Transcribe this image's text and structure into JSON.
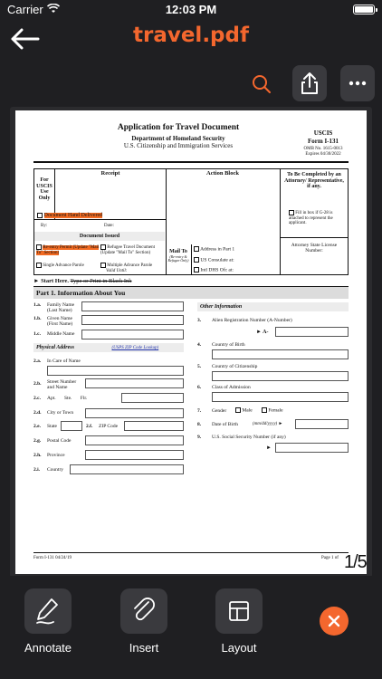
{
  "status_bar": {
    "carrier": "Carrier",
    "time": "12:03 PM"
  },
  "header": {
    "title": "travel.pdf"
  },
  "pdf": {
    "form_title": "Application for Travel Document",
    "dept": "Department of Homeland Security",
    "agency": "U.S. Citizenship and Immigration Services",
    "uscis": "USCIS",
    "form_no": "Form I-131",
    "omb": "OMB No. 1615-0013",
    "expires": "Expires 04/30/2022",
    "receipt": "Receipt",
    "action_block": "Action Block",
    "for_uscis_use_only": "For USCIS Use Only",
    "to_be_completed": "To Be Completed by an Attorney/ Representative, if any.",
    "document_hand_delivered": "Document Hand Delivered",
    "by": "By:",
    "date": "Date:",
    "document_issued": "Document Issued",
    "reentry_permit": "Re-entry Permit (Update \"Mail To\" Section)",
    "refugee_travel": "Refugee Travel Document (Update \"Mail To\" Section)",
    "single_parole": "Single Advance Parole",
    "multiple_parole": "Multiple Advance Parole",
    "valid_until": "Valid Until:",
    "mail_to": "Mail To",
    "mail_to_sub": "(Re-entry & Refugee Only)",
    "address_in_part1": "Address in Part 1",
    "us_consulate": "US Consulate at:",
    "intl_dhs": "Intl DHS Ofc at:",
    "fill_g28": "Fill in box if G-28 is attached to represent the applicant.",
    "attorney_license": "Attorney State License Number:",
    "start_here": "Start Here.",
    "type_or_print": "Type or Print in Black Ink",
    "part1": "Part 1.  Information About You",
    "other_info": "Other Information",
    "labels_left": [
      {
        "num": "1.a.",
        "text": "Family Name (Last Name)"
      },
      {
        "num": "1.b.",
        "text": "Given Name (First Name)"
      },
      {
        "num": "1.c.",
        "text": "Middle Name"
      }
    ],
    "physical_address": "Physical Address",
    "zip_lookup": "(USPS ZIP Code Lookup)",
    "addr_labels": [
      {
        "num": "2.a.",
        "text": "In Care of Name"
      },
      {
        "num": "2.b.",
        "text": "Street Number and Name"
      },
      {
        "num": "2.c.",
        "text": "Apt.   Ste.   Flr."
      },
      {
        "num": "2.d.",
        "text": "City or Town"
      },
      {
        "num": "2.e.",
        "text": "State"
      },
      {
        "num": "2.f.",
        "text": "ZIP Code"
      },
      {
        "num": "2.g.",
        "text": "Postal Code"
      },
      {
        "num": "2.h.",
        "text": "Province"
      },
      {
        "num": "2.i.",
        "text": "Country"
      }
    ],
    "right_labels": [
      {
        "num": "3.",
        "text": "Alien Registration Number (A-Number)"
      },
      {
        "num": "4.",
        "text": "Country of Birth"
      },
      {
        "num": "5.",
        "text": "Country of Citizenship"
      },
      {
        "num": "6.",
        "text": "Class of Admission"
      },
      {
        "num": "7.",
        "text": "Gender"
      },
      {
        "num": "8.",
        "text": "Date of Birth"
      },
      {
        "num": "9.",
        "text": "U.S. Social Security Number (if any)"
      }
    ],
    "a_prefix": "► A-",
    "male": "Male",
    "female": "Female",
    "dob_fmt": "(mm/dd/yyyy) ►",
    "footer_left": "Form I-131  04/24/19",
    "footer_right": "Page 1 of"
  },
  "page_indicator": "1/5",
  "bottom_bar": {
    "annotate": "Annotate",
    "insert": "Insert",
    "layout": "Layout"
  },
  "colors": {
    "accent": "#f4672e",
    "background": "#1f1f22",
    "button": "#3a3a3e"
  }
}
